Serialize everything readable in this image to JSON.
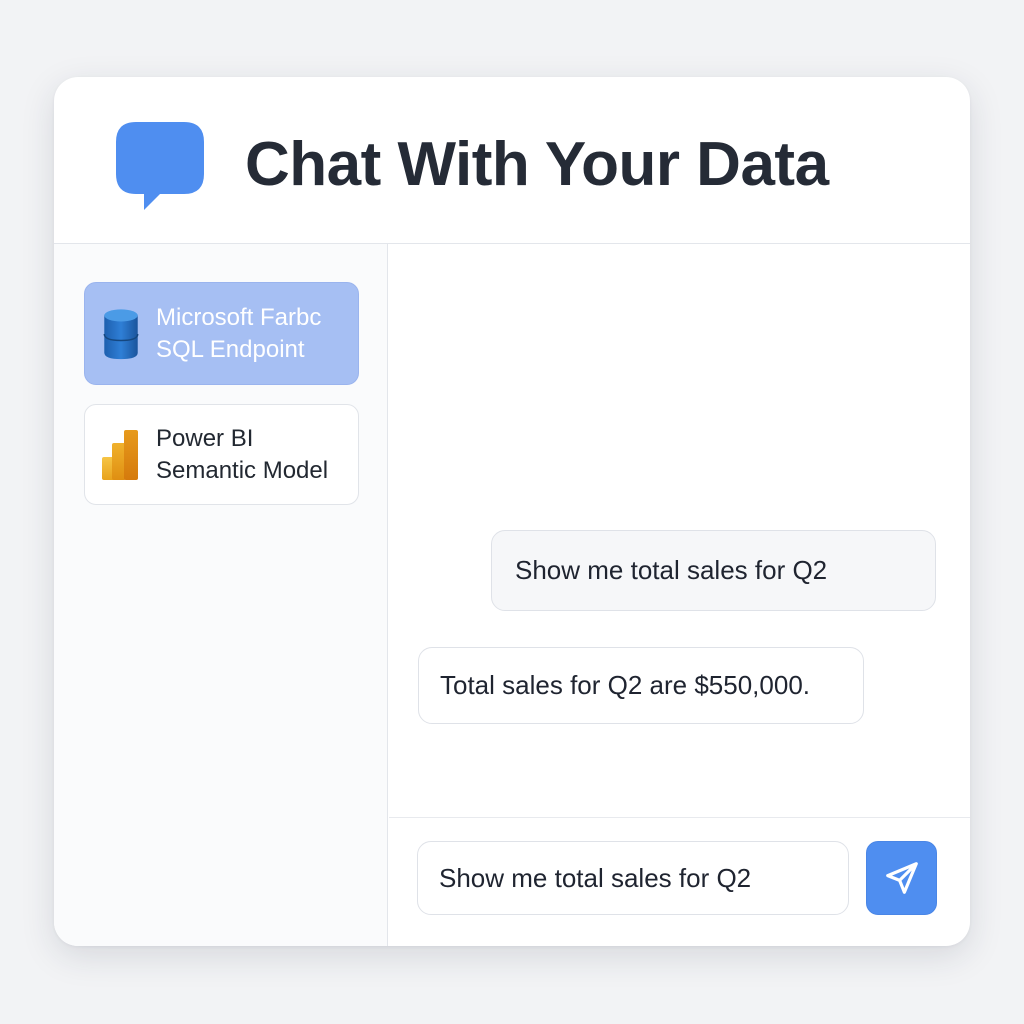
{
  "app": {
    "title": "Chat With Your Data",
    "logo_icon": "chat-bubble-icon",
    "accent_color": "#4f8ef0"
  },
  "sidebar": {
    "sources": [
      {
        "label_line1": "Microsoft Farbc",
        "label_line2": "SQL Endpoint",
        "icon": "database-icon",
        "active": true
      },
      {
        "label_line1": "Power BI",
        "label_line2": "Semantic Model",
        "icon": "power-bi-icon",
        "active": false
      }
    ]
  },
  "chat": {
    "messages": [
      {
        "role": "user",
        "text": "Show me total sales for Q2"
      },
      {
        "role": "assistant",
        "text": "Total sales for Q2 are $550,000."
      }
    ]
  },
  "composer": {
    "input_value": "Show me total sales for Q2",
    "send_icon": "send-icon"
  }
}
